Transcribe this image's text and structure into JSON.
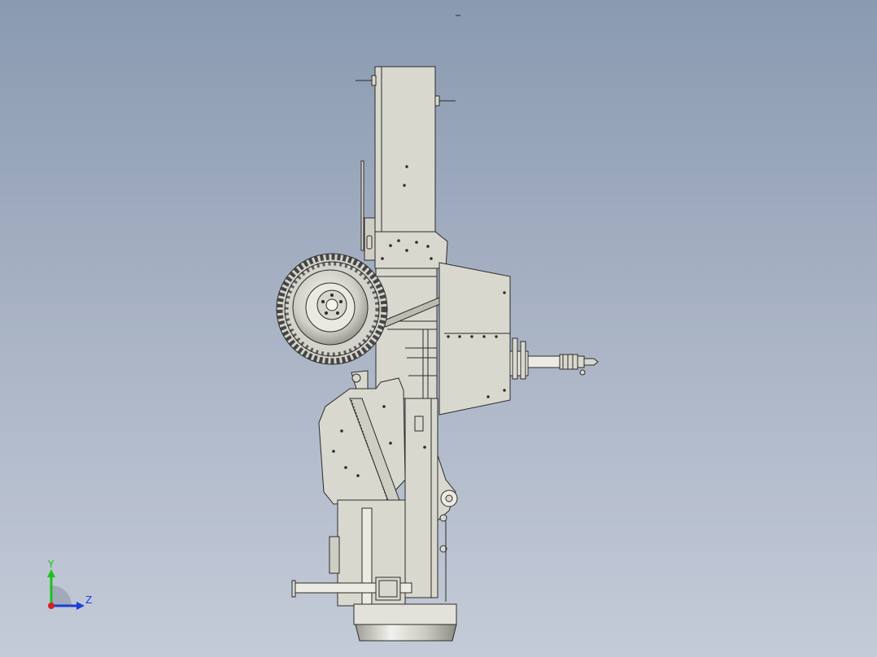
{
  "view": {
    "background_top": "#8a9ab0",
    "background_bottom": "#c4cbd8",
    "part_fill": "#d9d8cf",
    "edge_color": "#2b2b2b",
    "tire_fill": "#cfcfc6"
  },
  "triad": {
    "y_label": "Y",
    "z_label": "Z",
    "y_color": "#19c319",
    "z_color": "#1a3fd6",
    "x_color": "#d62020"
  },
  "icons": [
    "view-triad-icon"
  ]
}
